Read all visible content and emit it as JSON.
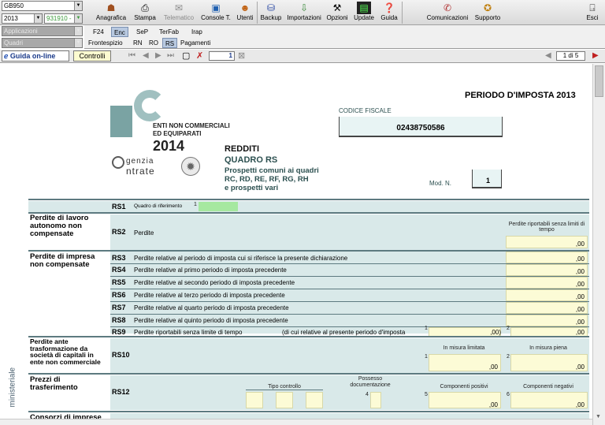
{
  "toolbar": {
    "combo1": "GB950",
    "combo2": "2013",
    "combo3": "931910 -",
    "combo4": "Applicazioni",
    "combo5": "Quadri",
    "buttons": [
      "Anagrafica",
      "Stampa",
      "Telematico",
      "Console T.",
      "Utenti",
      "Backup",
      "Importazioni",
      "Opzioni",
      "Update",
      "Guida",
      "Comunicazioni",
      "Supporto",
      "Esci"
    ]
  },
  "tabs": {
    "row1": [
      "F24",
      "Enc",
      "SeP",
      "TerFab",
      "Irap"
    ],
    "row2": [
      "Frontespizio",
      "RN",
      "RO",
      "RS",
      "Pagamenti"
    ]
  },
  "nav": {
    "guida": "Guida on-line",
    "controlli": "Controlli",
    "page_num": "1",
    "page_of": "1 di 5"
  },
  "header": {
    "periodo": "PERIODO D'IMPOSTA 2013",
    "codice_fiscale_label": "CODICE FISCALE",
    "codice_fiscale": "02438750586",
    "logo_line1": "ENTI NON COMMERCIALI",
    "logo_line2": "ED EQUIPARATI",
    "logo_year": "2014",
    "agenzia": "genzia",
    "entrate": "ntrate",
    "redditi": "REDDITI",
    "quadro": "QUADRO RS",
    "sub1": "Prospetti comuni ai quadri",
    "sub2": "RC, RD, RE, RF, RG, RH",
    "sub3": "e prospetti vari",
    "mod_label": "Mod. N.",
    "mod_num": "1"
  },
  "side_label": "ministeriale",
  "rows": {
    "rs1": {
      "code": "RS1",
      "desc": "Quadro di riferimento",
      "n": "1"
    },
    "rs2_section": "Perdite di lavoro autonomo non compensate",
    "rs2": {
      "code": "RS2",
      "desc": "Perdite",
      "col": "Perdite riportabili senza limiti di tempo",
      "val": ",00"
    },
    "imp_section": "Perdite di impresa non compensate",
    "rs3": {
      "code": "RS3",
      "desc": "Perdite relative al periodo di imposta cui si riferisce la presente dichiarazione",
      "val": ",00"
    },
    "rs4": {
      "code": "RS4",
      "desc": "Perdite relative al primo periodo di imposta precedente",
      "val": ",00"
    },
    "rs5": {
      "code": "RS5",
      "desc": "Perdite relative al secondo periodo di imposta precedente",
      "val": ",00"
    },
    "rs6": {
      "code": "RS6",
      "desc": "Perdite relative al terzo periodo di imposta precedente",
      "val": ",00"
    },
    "rs7": {
      "code": "RS7",
      "desc": "Perdite relative al quarto periodo di imposta precedente",
      "val": ",00"
    },
    "rs8": {
      "code": "RS8",
      "desc": "Perdite relative al quinto periodo di imposta precedente",
      "val": ",00"
    },
    "rs9": {
      "code": "RS9",
      "desc": "Perdite riportabili senza limite di tempo",
      "desc2": "(di cui relative al presente periodo d'imposta",
      "n1": "1",
      "v1": ",00)",
      "n2": "2",
      "v2": ",00"
    },
    "rs10_section": "Perdite ante trasformazione da società di capitali in ente non commerciale",
    "rs10": {
      "code": "RS10",
      "col1": "In misura limitata",
      "col2": "In misura piena",
      "n1": "1",
      "n2": "2",
      "v1": ",00",
      "v2": ",00"
    },
    "rs12_section": "Prezzi di trasferimento",
    "rs12": {
      "code": "RS12",
      "tipo": "Tipo controllo",
      "possesso": "Possesso documentazione",
      "pos": "Componenti positivi",
      "neg": "Componenti negativi",
      "n4": "4",
      "n5": "5",
      "n6": "6",
      "v5": ",00",
      "v6": ",00"
    },
    "consorzi_section": "Consorzi di imprese"
  },
  "colors": {
    "accent": "#5d7a80",
    "row_bg": "#d9e9e9",
    "field": "#fcfbd6"
  }
}
